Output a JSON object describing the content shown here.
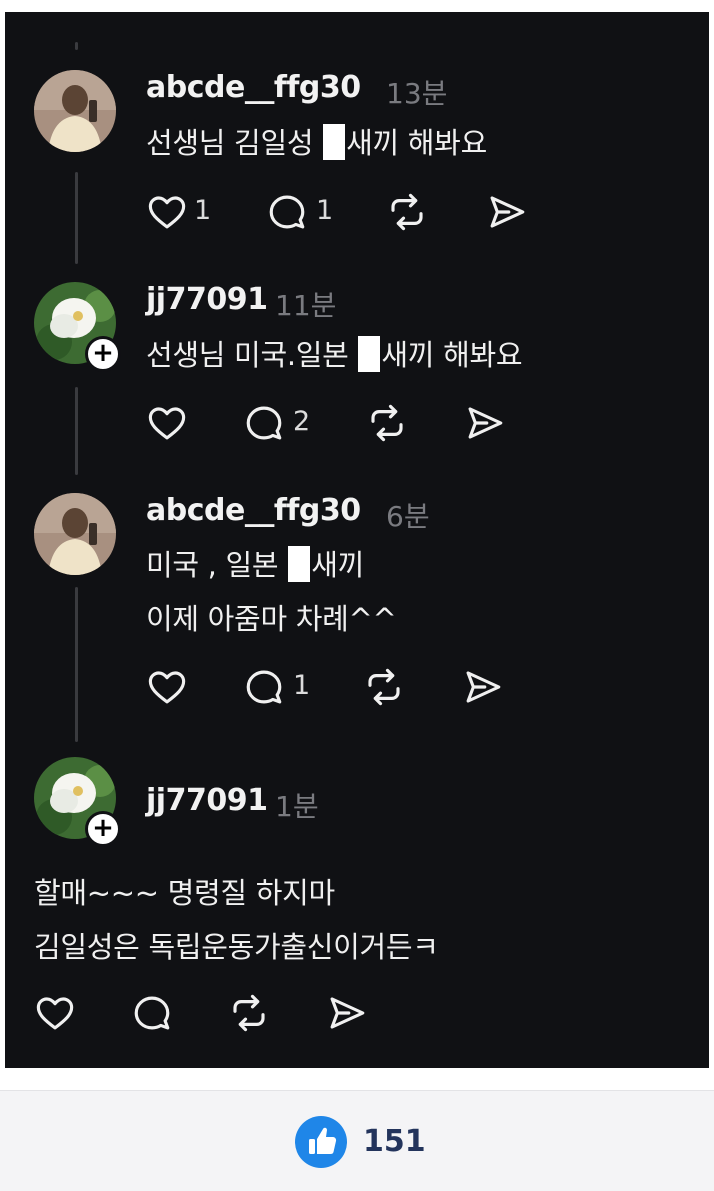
{
  "comments": [
    {
      "username": "abcde__ffg30",
      "time": "13분",
      "text_before": "선생님 김일성 ",
      "text_after": "새끼 해봐요",
      "likes": "1",
      "replies": "1"
    },
    {
      "username": "jj77091",
      "time": "11분",
      "text_before": "선생님 미국.일본 ",
      "text_after": "새끼 해봐요",
      "likes": "",
      "replies": "2"
    },
    {
      "username": "abcde__ffg30",
      "time": "6분",
      "text_before": "미국 , 일본 ",
      "text_after": "새끼",
      "text_line2": "이제 아줌마 차례^^",
      "likes": "",
      "replies": "1"
    },
    {
      "username": "jj77091",
      "time": "1분",
      "text_line1": "할매~~~ 명령질 하지마",
      "text_line2": "김일성은 독립운동가출신이거든ㅋ",
      "likes": "",
      "replies": ""
    }
  ],
  "icons": {
    "like": "heart-icon",
    "reply": "comment-bubble-icon",
    "repost": "repost-icon",
    "share": "send-icon",
    "follow": "plus-icon",
    "reaction": "thumbs-up-icon"
  },
  "footer": {
    "like_count": "151"
  },
  "colors": {
    "background": "#101114",
    "text": "#f0f0f0",
    "muted": "#7a7b80",
    "accent": "#1f86e8"
  }
}
